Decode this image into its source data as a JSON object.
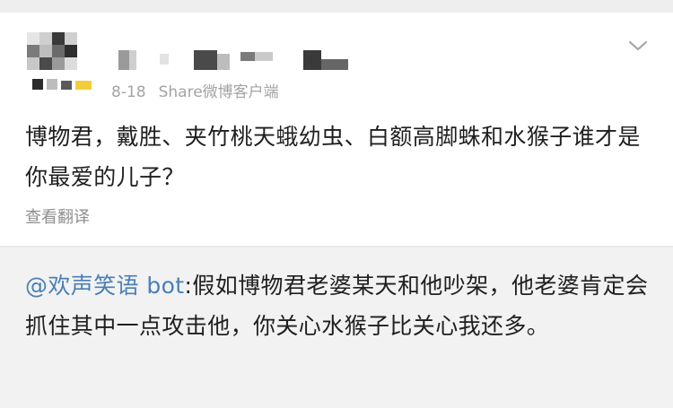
{
  "post": {
    "date": "8-18",
    "source": "Share微博客户端",
    "text": "博物君，戴胜、夹竹桃天蛾幼虫、白额高脚蛛和水猴子谁才是你最爱的儿子？",
    "translate_label": "查看翻译",
    "menu_icon": "chevron-down-icon"
  },
  "reply": {
    "mention": "@欢声笑语 bot",
    "text": ":假如博物君老婆某天和他吵架，他老婆肯定会抓住其中一点攻击他，你关心水猴子比关心我还多。"
  },
  "colors": {
    "mention": "#4a7fb6",
    "meta": "#a3a3a3",
    "reply_background": "#f2f2f2"
  }
}
